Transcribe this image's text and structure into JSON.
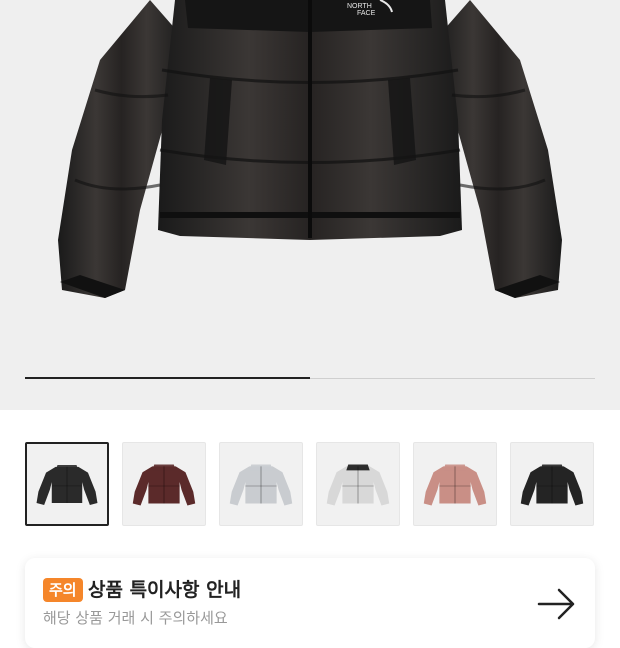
{
  "hero": {
    "image": "black-puffer-jacket",
    "slider_progress": 0.5
  },
  "thumbnails": [
    {
      "name": "black-glossy-puffer",
      "color": "#2a2a2a",
      "selected": true
    },
    {
      "name": "burgundy-puffer",
      "color": "#5b2a2a",
      "selected": false
    },
    {
      "name": "silver-puffer",
      "color": "#c9ccd0",
      "selected": false
    },
    {
      "name": "white-black-puffer",
      "color": "#d8d8d8",
      "selected": false
    },
    {
      "name": "pink-puffer",
      "color": "#c98f86",
      "selected": false
    },
    {
      "name": "black-matte-puffer",
      "color": "#242424",
      "selected": false
    }
  ],
  "notice": {
    "badge": "주의",
    "title": "상품 특이사항 안내",
    "description": "해당 상품 거래 시 주의하세요",
    "accent_color": "#f5862a"
  }
}
